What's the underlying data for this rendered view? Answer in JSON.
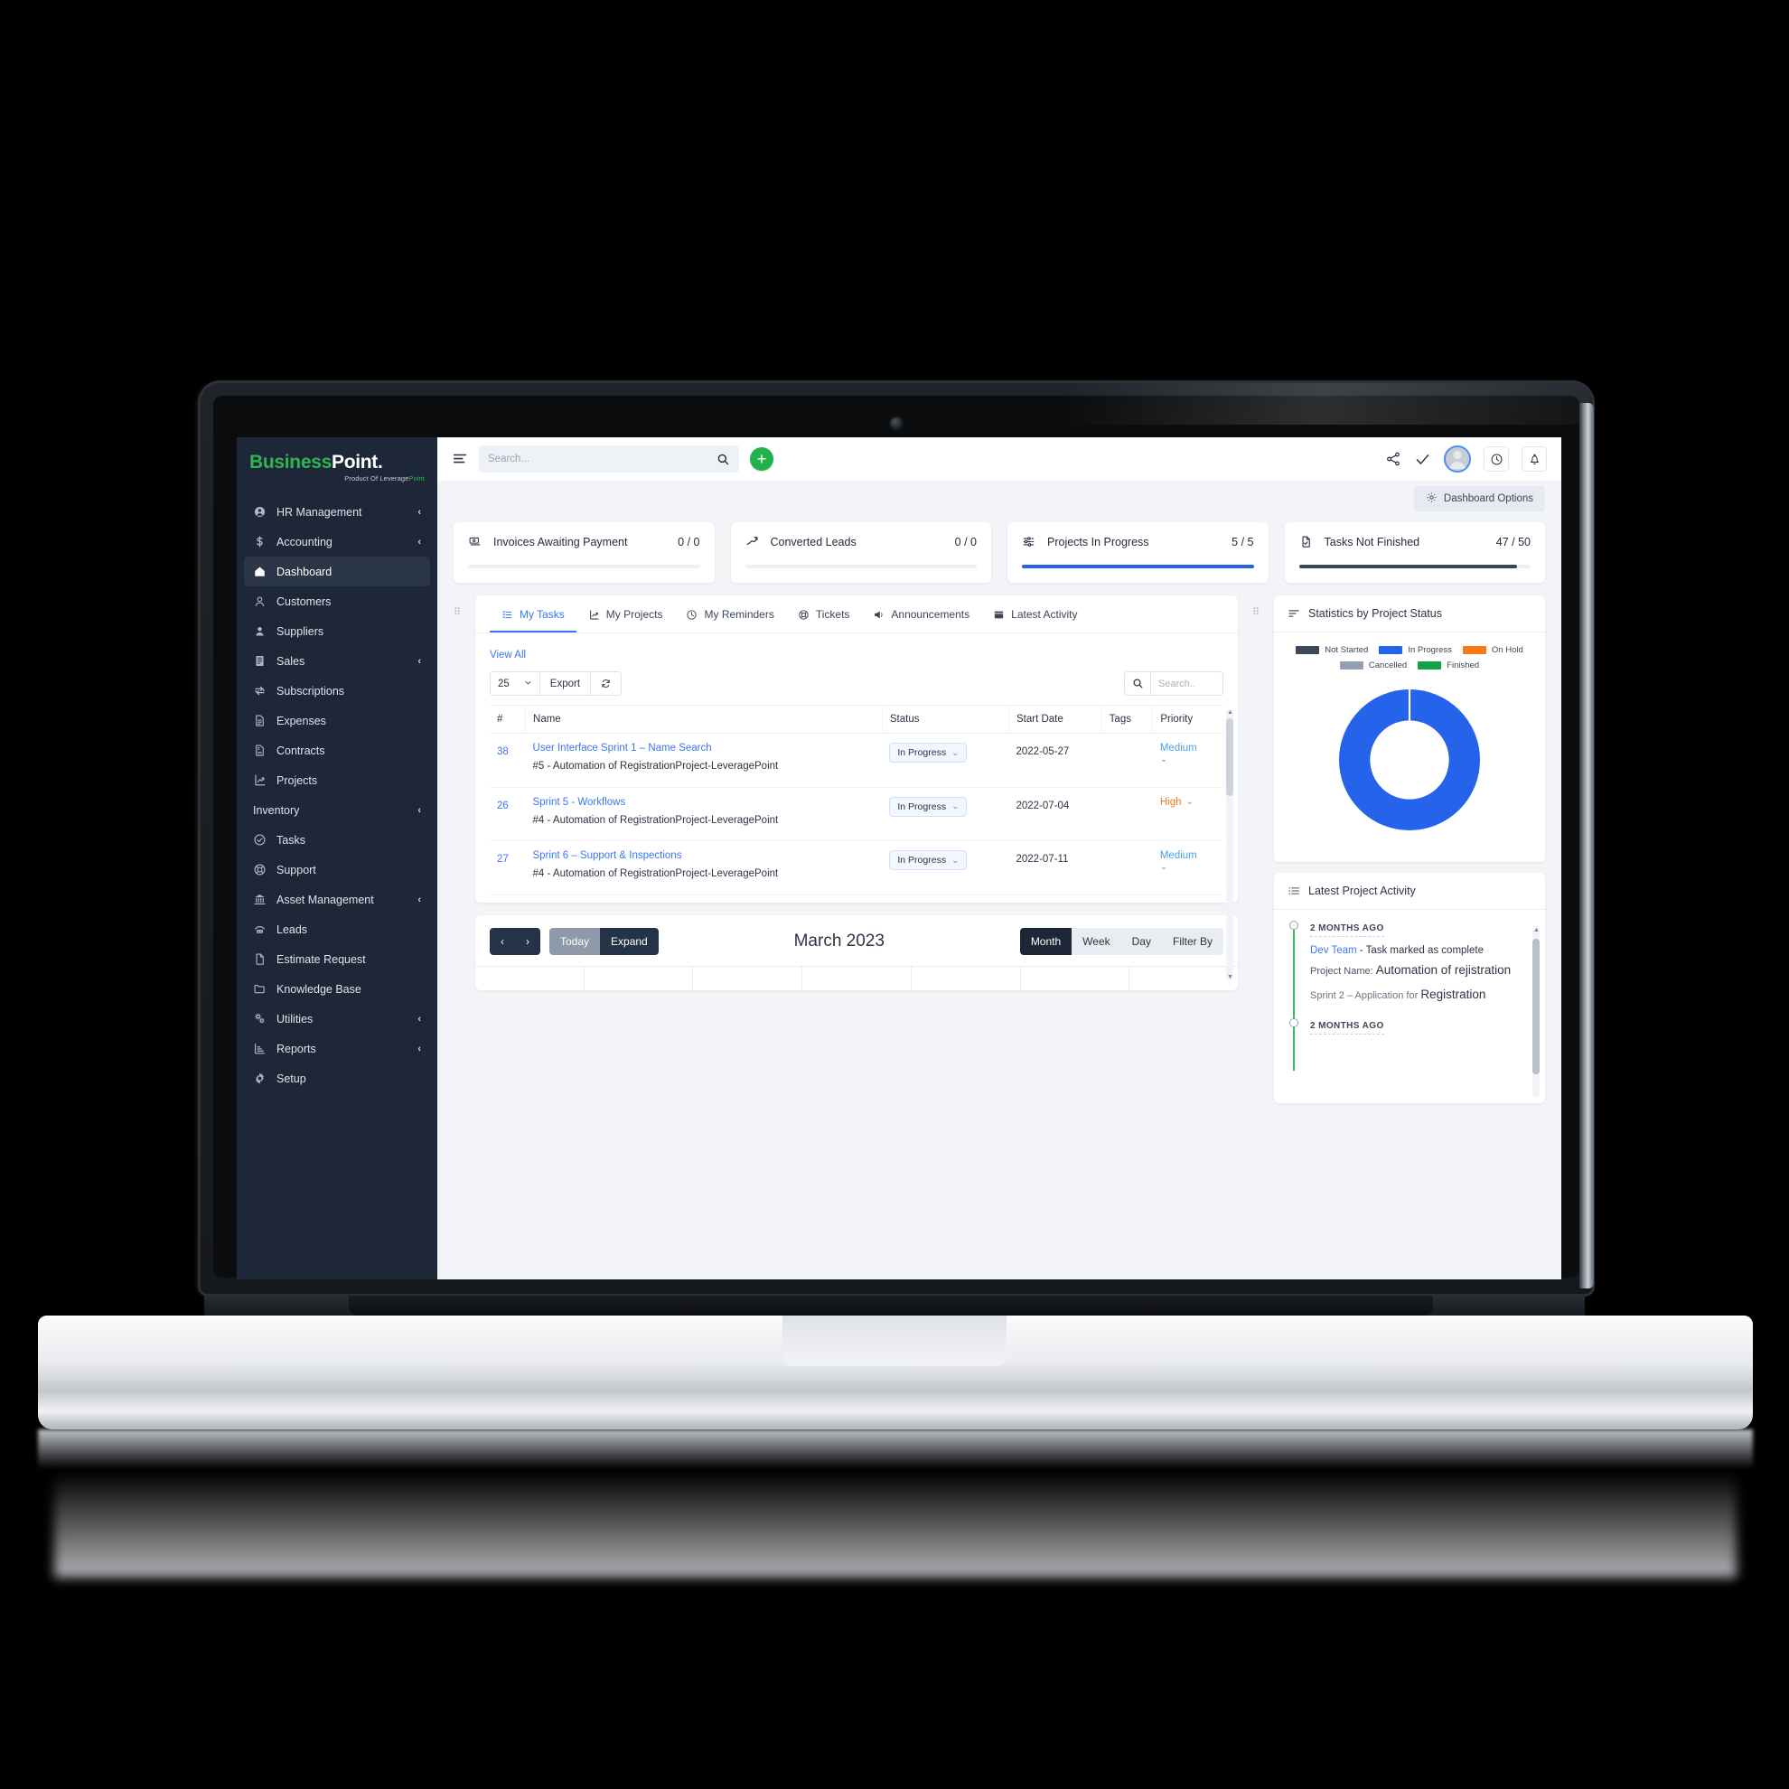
{
  "brand": {
    "name_part1": "Business",
    "name_part2": "Point.",
    "tagline_pre": "Product Of Leverage",
    "tagline_hl": "Point"
  },
  "sidebar": {
    "items": [
      {
        "label": "HR Management",
        "icon": "user-circle-icon",
        "chevron": "‹",
        "active": false
      },
      {
        "label": "Accounting",
        "icon": "dollar-icon",
        "chevron": "‹",
        "active": false
      },
      {
        "label": "Dashboard",
        "icon": "home-icon",
        "chevron": "",
        "active": true
      },
      {
        "label": "Customers",
        "icon": "user-outline-icon",
        "chevron": "",
        "active": false
      },
      {
        "label": "Suppliers",
        "icon": "user-filled-icon",
        "chevron": "",
        "active": false
      },
      {
        "label": "Sales",
        "icon": "receipt-icon",
        "chevron": "‹",
        "active": false
      },
      {
        "label": "Subscriptions",
        "icon": "refresh-cycle-icon",
        "chevron": "",
        "active": false
      },
      {
        "label": "Expenses",
        "icon": "document-lines-icon",
        "chevron": "",
        "active": false
      },
      {
        "label": "Contracts",
        "icon": "contract-icon",
        "chevron": "",
        "active": false
      },
      {
        "label": "Projects",
        "icon": "projects-chart-icon",
        "chevron": "",
        "active": false
      },
      {
        "label": "Inventory",
        "icon": "",
        "chevron": "‹",
        "active": false
      },
      {
        "label": "Tasks",
        "icon": "check-circle-icon",
        "chevron": "",
        "active": false
      },
      {
        "label": "Support",
        "icon": "lifebuoy-icon",
        "chevron": "",
        "active": false
      },
      {
        "label": "Asset Management",
        "icon": "bank-icon",
        "chevron": "‹",
        "active": false
      },
      {
        "label": "Leads",
        "icon": "phone-icon",
        "chevron": "",
        "active": false
      },
      {
        "label": "Estimate Request",
        "icon": "file-icon",
        "chevron": "",
        "active": false
      },
      {
        "label": "Knowledge Base",
        "icon": "folder-icon",
        "chevron": "",
        "active": false
      },
      {
        "label": "Utilities",
        "icon": "cogs-icon",
        "chevron": "‹",
        "active": false
      },
      {
        "label": "Reports",
        "icon": "bar-chart-icon",
        "chevron": "‹",
        "active": false
      },
      {
        "label": "Setup",
        "icon": "gear-icon",
        "chevron": "",
        "active": false
      }
    ]
  },
  "topbar": {
    "search_placeholder": "Search...",
    "add_label": "+",
    "icons": [
      "share-icon",
      "check-icon",
      "avatar",
      "clock-icon",
      "bell-icon"
    ]
  },
  "dashboard_options": {
    "label": "Dashboard Options"
  },
  "cards": [
    {
      "label": "Invoices Awaiting Payment",
      "value": "0 / 0",
      "icon": "invoice-icon",
      "progress_pct": 0,
      "bar_color": "#eceff4"
    },
    {
      "label": "Converted Leads",
      "value": "0 / 0",
      "icon": "trend-up-icon",
      "progress_pct": 0,
      "bar_color": "#eceff4"
    },
    {
      "label": "Projects In Progress",
      "value": "5 / 5",
      "icon": "sliders-icon",
      "progress_pct": 100,
      "bar_color": "#2563eb"
    },
    {
      "label": "Tasks Not Finished",
      "value": "47 / 50",
      "icon": "task-file-icon",
      "progress_pct": 94,
      "bar_color": "#3b4658"
    }
  ],
  "tabs": [
    {
      "label": "My Tasks",
      "icon": "task-list-icon",
      "active": true
    },
    {
      "label": "My Projects",
      "icon": "projects-chart-icon",
      "active": false
    },
    {
      "label": "My Reminders",
      "icon": "clock-icon",
      "active": false
    },
    {
      "label": "Tickets",
      "icon": "lifebuoy-icon",
      "active": false
    },
    {
      "label": "Announcements",
      "icon": "megaphone-icon",
      "active": false
    },
    {
      "label": "Latest Activity",
      "icon": "window-icon",
      "active": false
    }
  ],
  "tasks_panel": {
    "view_all": "View All",
    "page_size": "25",
    "export_label": "Export",
    "refresh_icon": "refresh-icon",
    "search_placeholder": "Search..",
    "columns": [
      "#",
      "Name",
      "Status",
      "Start Date",
      "Tags",
      "Priority"
    ],
    "rows": [
      {
        "id": "38",
        "name": "User Interface Sprint 1 – Name Search",
        "sub_line1": "#5 - Automation of Registration",
        "sub_line2": "Project-LeveragePoint",
        "status": "In Progress",
        "start_date": "2022-05-27",
        "tags": "",
        "priority": "Medium",
        "priority_class": "medium",
        "priority_inline": false
      },
      {
        "id": "26",
        "name": "Sprint 5 - Workflows",
        "sub_line1": "#4 - Automation of Registration",
        "sub_line2": "Project-LeveragePoint",
        "status": "In Progress",
        "start_date": "2022-07-04",
        "tags": "",
        "priority": "High",
        "priority_class": "high",
        "priority_inline": true
      },
      {
        "id": "27",
        "name": "Sprint 6 – Support & Inspections",
        "sub_line1": "#4 - Automation of Registration",
        "sub_line2": "Project-LeveragePoint",
        "status": "In Progress",
        "start_date": "2022-07-11",
        "tags": "",
        "priority": "Medium",
        "priority_class": "medium",
        "priority_inline": false
      }
    ]
  },
  "calendar": {
    "prev": "‹",
    "next": "›",
    "today": "Today",
    "expand": "Expand",
    "title": "March 2023",
    "views": [
      {
        "label": "Month",
        "active": true
      },
      {
        "label": "Week",
        "active": false
      },
      {
        "label": "Day",
        "active": false
      },
      {
        "label": "Filter By",
        "active": false
      }
    ]
  },
  "stats_panel": {
    "title": "Statistics by Project Status"
  },
  "chart_data": {
    "type": "pie",
    "title": "Statistics by Project Status",
    "legend_position": "top",
    "categories": [
      "Not Started",
      "In Progress",
      "On Hold",
      "Cancelled",
      "Finished"
    ],
    "values": [
      0,
      5,
      0,
      0,
      0
    ],
    "colors": [
      "#3d4759",
      "#2563eb",
      "#f47b16",
      "#93a0b4",
      "#15a14a"
    ],
    "donut": true,
    "inner_radius_ratio": 0.56
  },
  "activity_panel": {
    "title": "Latest Project Activity",
    "items": [
      {
        "time": "2 MONTHS AGO",
        "actor": "Dev Team",
        "action": " - Task marked as complete",
        "project_label": "Project Name:",
        "project_name": "Automation of re­jistration",
        "detail_label": "Sprint 2 – Application for",
        "detail_value": "Registration"
      },
      {
        "time": "2 MONTHS AGO",
        "actor": "",
        "action": "",
        "project_label": "",
        "project_name": "",
        "detail_label": "",
        "detail_value": ""
      }
    ]
  }
}
